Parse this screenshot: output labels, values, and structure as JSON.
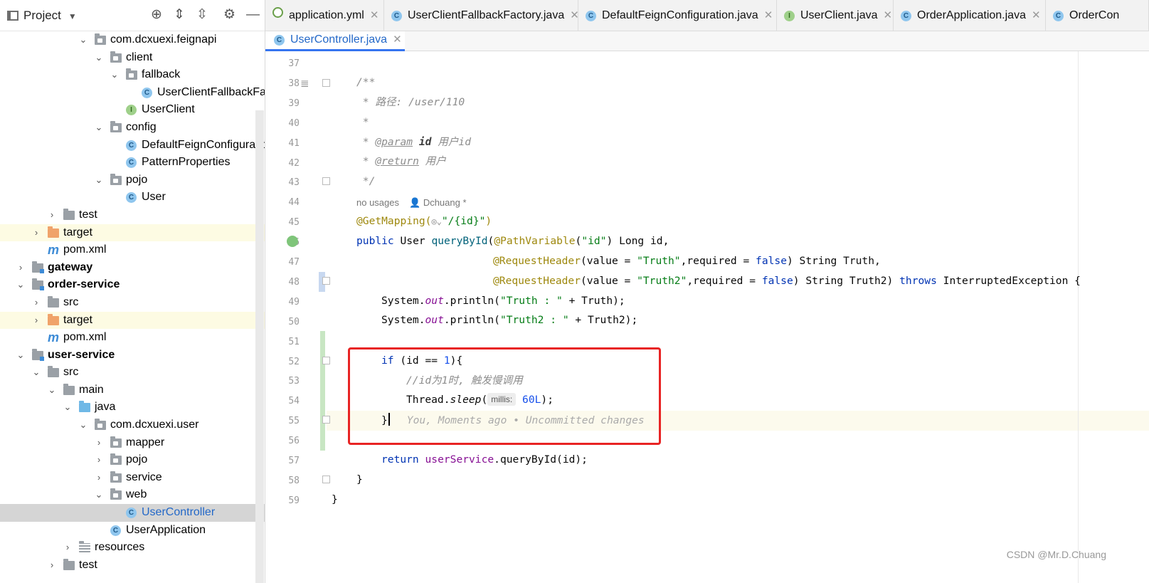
{
  "panel": {
    "title": "Project"
  },
  "tree": [
    {
      "label": "com.dcxuexi.feignapi",
      "indent": 0,
      "chev": "⌄",
      "icon": "pkg",
      "bold": false
    },
    {
      "label": "client",
      "indent": 1,
      "chev": "⌄",
      "icon": "pkg",
      "bold": false
    },
    {
      "label": "fallback",
      "indent": 2,
      "chev": "⌄",
      "icon": "pkg",
      "bold": false
    },
    {
      "label": "UserClientFallbackFac",
      "indent": 3,
      "chev": "",
      "icon": "class",
      "bold": false
    },
    {
      "label": "UserClient",
      "indent": 2,
      "chev": "",
      "icon": "interface",
      "bold": false
    },
    {
      "label": "config",
      "indent": 1,
      "chev": "⌄",
      "icon": "pkg",
      "bold": false
    },
    {
      "label": "DefaultFeignConfiguratio",
      "indent": 2,
      "chev": "",
      "icon": "class",
      "bold": false
    },
    {
      "label": "PatternProperties",
      "indent": 2,
      "chev": "",
      "icon": "class",
      "bold": false
    },
    {
      "label": "pojo",
      "indent": 1,
      "chev": "⌄",
      "icon": "pkg",
      "bold": false
    },
    {
      "label": "User",
      "indent": 2,
      "chev": "",
      "icon": "class",
      "bold": false
    },
    {
      "label": "test",
      "indent": -2,
      "chev": "›",
      "icon": "folder",
      "bold": false
    },
    {
      "label": "target",
      "indent": -3,
      "chev": "›",
      "icon": "folder-orange",
      "bold": false,
      "highlight": true
    },
    {
      "label": "pom.xml",
      "indent": -3,
      "chev": "",
      "icon": "maven",
      "bold": false
    },
    {
      "label": "gateway",
      "indent": -4,
      "chev": "›",
      "icon": "module",
      "bold": true
    },
    {
      "label": "order-service",
      "indent": -4,
      "chev": "⌄",
      "icon": "module",
      "bold": true
    },
    {
      "label": "src",
      "indent": -3,
      "chev": "›",
      "icon": "folder",
      "bold": false
    },
    {
      "label": "target",
      "indent": -3,
      "chev": "›",
      "icon": "folder-orange",
      "bold": false,
      "highlight": true
    },
    {
      "label": "pom.xml",
      "indent": -3,
      "chev": "",
      "icon": "maven",
      "bold": false
    },
    {
      "label": "user-service",
      "indent": -4,
      "chev": "⌄",
      "icon": "module",
      "bold": true
    },
    {
      "label": "src",
      "indent": -3,
      "chev": "⌄",
      "icon": "folder",
      "bold": false
    },
    {
      "label": "main",
      "indent": -2,
      "chev": "⌄",
      "icon": "folder",
      "bold": false
    },
    {
      "label": "java",
      "indent": -1,
      "chev": "⌄",
      "icon": "folder-blue",
      "bold": false
    },
    {
      "label": "com.dcxuexi.user",
      "indent": 0,
      "chev": "⌄",
      "icon": "pkg",
      "bold": false
    },
    {
      "label": "mapper",
      "indent": 1,
      "chev": "›",
      "icon": "pkg",
      "bold": false
    },
    {
      "label": "pojo",
      "indent": 1,
      "chev": "›",
      "icon": "pkg",
      "bold": false
    },
    {
      "label": "service",
      "indent": 1,
      "chev": "›",
      "icon": "pkg",
      "bold": false
    },
    {
      "label": "web",
      "indent": 1,
      "chev": "⌄",
      "icon": "pkg",
      "bold": false
    },
    {
      "label": "UserController",
      "indent": 2,
      "chev": "",
      "icon": "class",
      "bold": false,
      "selected": true
    },
    {
      "label": "UserApplication",
      "indent": 1,
      "chev": "",
      "icon": "class",
      "bold": false
    },
    {
      "label": "resources",
      "indent": -1,
      "chev": "›",
      "icon": "res",
      "bold": false
    },
    {
      "label": "test",
      "indent": -2,
      "chev": "›",
      "icon": "folder",
      "bold": false
    }
  ],
  "tabs": [
    {
      "label": "application.yml",
      "icon": "yml"
    },
    {
      "label": "UserClientFallbackFactory.java",
      "icon": "C"
    },
    {
      "label": "DefaultFeignConfiguration.java",
      "icon": "C"
    },
    {
      "label": "UserClient.java",
      "icon": "I"
    },
    {
      "label": "OrderApplication.java",
      "icon": "C"
    },
    {
      "label": "OrderCon",
      "icon": "C"
    }
  ],
  "active_tab": {
    "label": "UserController.java",
    "icon": "C"
  },
  "line_numbers": [
    "37",
    "38",
    "39",
    "40",
    "41",
    "42",
    "43",
    "44",
    "45",
    "46",
    "47",
    "48",
    "49",
    "50",
    "51",
    "52",
    "53",
    "54",
    "55",
    "56",
    "57",
    "58",
    "59"
  ],
  "code": {
    "l38": "/**",
    "l39_a": " * ",
    "l39_b": "路径: /user/110",
    "l40": " *",
    "l41_a": " * ",
    "l41_tag": "@param",
    "l41_b": " id",
    "l41_c": " 用户id",
    "l42_a": " * ",
    "l42_tag": "@return",
    "l42_c": " 用户",
    "l43": " */",
    "meta_usages": "no usages",
    "meta_author": "Dchuang *",
    "l44_ann": "@GetMapping(",
    "l44_str": "\"/{id}\"",
    "l44_end": ")",
    "l45_kw": "public",
    "l45_a": " User ",
    "l45_fn": "queryById",
    "l45_b": "(",
    "l45_ann": "@PathVariable",
    "l45_c": "(",
    "l45_str": "\"id\"",
    "l45_d": ") Long id,",
    "l46_ann": "@RequestHeader",
    "l46_a": "(value = ",
    "l46_str": "\"Truth\"",
    "l46_b": ",required = ",
    "l46_lit": "false",
    "l46_c": ") String ",
    "l46_var": "Truth,",
    "l47_ann": "@RequestHeader",
    "l47_a": "(value = ",
    "l47_str": "\"Truth2\"",
    "l47_b": ",required = ",
    "l47_lit": "false",
    "l47_c": ") String ",
    "l47_var": "Truth2)",
    "l47_kw": " throws",
    "l47_d": " InterruptedException {",
    "l48_a": "System.",
    "l48_fld": "out",
    "l48_b": ".println(",
    "l48_str": "\"Truth : \"",
    "l48_c": " + Truth);",
    "l49_a": "System.",
    "l49_fld": "out",
    "l49_b": ".println(",
    "l49_str": "\"Truth2 : \"",
    "l49_c": " + Truth2);",
    "l51_kw": "if",
    "l51_a": " (id == ",
    "l51_nu": "1",
    "l51_b": "){",
    "l52": "//id为1时, 触发慢调用",
    "l53_a": "Thread.",
    "l53_fn": "sleep",
    "l53_b": "(",
    "l53_hint": "millis:",
    "l53_nu": " 60L",
    "l53_c": ");",
    "l54_brace": "}",
    "l54_blame": "You, Moments ago • Uncommitted changes",
    "l56_kw": "return",
    "l56_a": " ",
    "l56_fld": "userService",
    "l56_b": ".queryById(id);",
    "l57": "}",
    "l58": "}"
  },
  "watermark": "CSDN @Mr.D.Chuang"
}
